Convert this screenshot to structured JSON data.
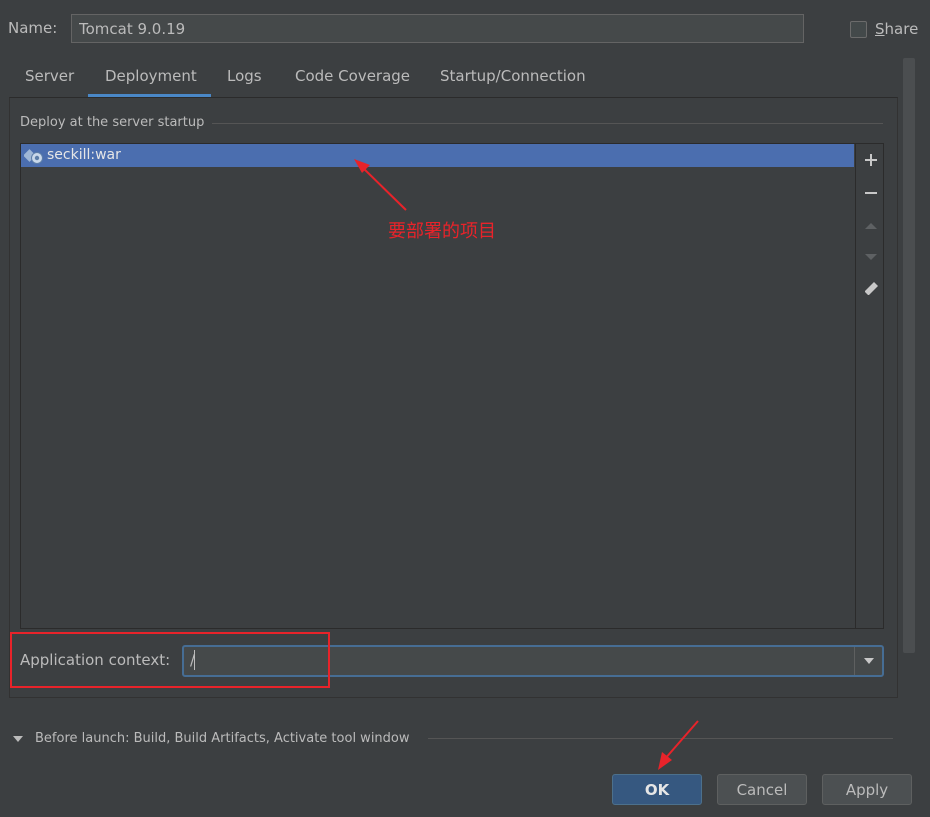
{
  "form": {
    "name_label": "Name:",
    "name_value": "Tomcat 9.0.19",
    "share_label_first": "S",
    "share_label_rest": "hare"
  },
  "tabs": [
    {
      "label": "Server"
    },
    {
      "label": "Deployment",
      "selected": true
    },
    {
      "label": "Logs"
    },
    {
      "label": "Code Coverage"
    },
    {
      "label": "Startup/Connection"
    }
  ],
  "deployment": {
    "section_title": "Deploy at the server startup",
    "artifacts": [
      {
        "label": "seckill:war",
        "icon": "artifact-war-icon"
      }
    ],
    "toolbar_icons": [
      "add-icon",
      "remove-icon",
      "move-up-icon",
      "move-down-icon",
      "edit-icon"
    ],
    "annotation": "要部署的项目",
    "context_label": "Application context:",
    "context_value": "/"
  },
  "before_launch": {
    "label": "Before launch: Build, Build Artifacts, Activate tool window"
  },
  "buttons": {
    "ok": "OK",
    "cancel": "Cancel",
    "apply": "Apply"
  },
  "colors": {
    "background": "#3c3f41",
    "selection": "#4b6eaf",
    "accent": "#4a88c7",
    "annotation": "#e8232a",
    "primary_button": "#365880"
  }
}
